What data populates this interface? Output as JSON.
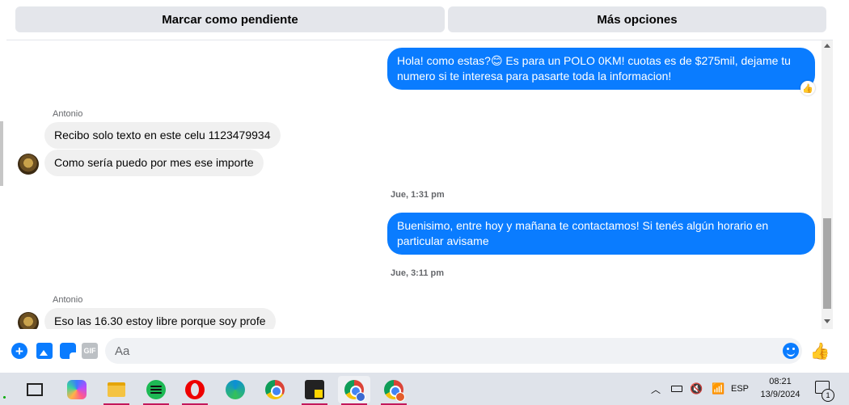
{
  "action_bar": {
    "mark_pending": "Marcar como pendiente",
    "more_options": "Más opciones"
  },
  "messages": [
    {
      "type": "outgoing",
      "text": "Hola! como estas?😊 Es para un POLO 0KM! cuotas es de $275mil, dejame tu numero si te interesa para pasarte toda la informacion!",
      "reaction": "👍"
    },
    {
      "type": "sender",
      "text": "Antonio"
    },
    {
      "type": "incoming",
      "text": "Recibo solo texto en este celu 1123479934"
    },
    {
      "type": "incoming",
      "text": "Como sería puedo por mes ese importe"
    },
    {
      "type": "timestamp",
      "text": "Jue, 1:31 pm"
    },
    {
      "type": "outgoing",
      "text": "Buenisimo, entre hoy y mañana te contactamos! Si tenés algún horario en particular avisame"
    },
    {
      "type": "timestamp",
      "text": "Jue, 3:11 pm"
    },
    {
      "type": "sender",
      "text": "Antonio"
    },
    {
      "type": "incoming",
      "text": "Eso las 16.30 estoy libre porque soy profe"
    }
  ],
  "composer": {
    "placeholder": "Aa",
    "gif_label": "GIF",
    "icons": [
      "plus-icon",
      "image-icon",
      "sticker-icon",
      "gif-icon",
      "emoji-icon",
      "like-icon"
    ]
  },
  "taskbar": {
    "apps": [
      "task-view",
      "copilot",
      "file-explorer",
      "spotify",
      "opera",
      "edge",
      "chrome",
      "sticky-notes",
      "chrome-profile",
      "chrome-profile-2"
    ],
    "lang": "ESP",
    "time": "08:21",
    "date": "13/9/2024",
    "notifications": "1"
  },
  "colors": {
    "accent": "#0a7cff",
    "incoming_bubble": "#f0f0f0",
    "taskbar": "#dfe3ea"
  }
}
